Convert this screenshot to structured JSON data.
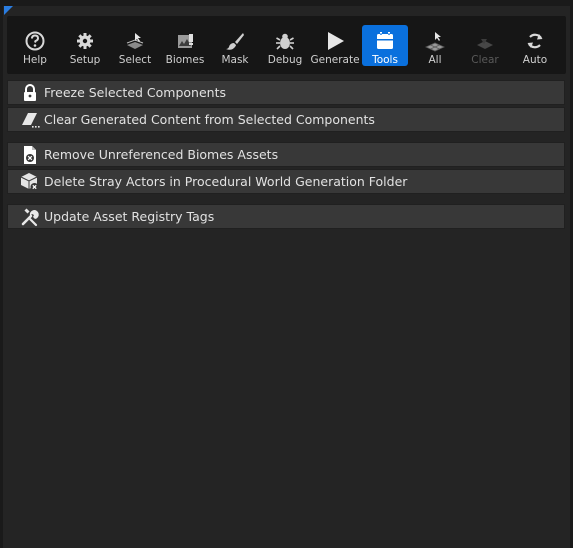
{
  "toolbar": {
    "items": [
      {
        "label": "Help",
        "icon": "help-icon"
      },
      {
        "label": "Setup",
        "icon": "gear-icon"
      },
      {
        "label": "Select",
        "icon": "select-icon"
      },
      {
        "label": "Biomes",
        "icon": "biomes-icon"
      },
      {
        "label": "Mask",
        "icon": "brush-icon"
      },
      {
        "label": "Debug",
        "icon": "bug-icon"
      },
      {
        "label": "Generate",
        "icon": "play-icon"
      },
      {
        "label": "Tools",
        "icon": "tools-icon",
        "active": true
      },
      {
        "label": "All",
        "icon": "all-icon"
      },
      {
        "label": "Clear",
        "icon": "clear-icon",
        "disabled": true
      },
      {
        "label": "Auto",
        "icon": "refresh-icon"
      }
    ]
  },
  "actions": [
    {
      "label": "Freeze Selected Components",
      "icon": "lock-icon"
    },
    {
      "label": "Clear Generated Content from Selected Components",
      "icon": "eraser-icon"
    },
    {
      "label": "Remove Unreferenced Biomes Assets",
      "icon": "file-remove-icon"
    },
    {
      "label": "Delete Stray Actors in Procedural World Generation Folder",
      "icon": "actor-delete-icon"
    },
    {
      "label": "Update Asset Registry Tags",
      "icon": "wrench-icon"
    }
  ],
  "colors": {
    "accent": "#0a70dd",
    "background": "#242424",
    "row": "#383838"
  }
}
